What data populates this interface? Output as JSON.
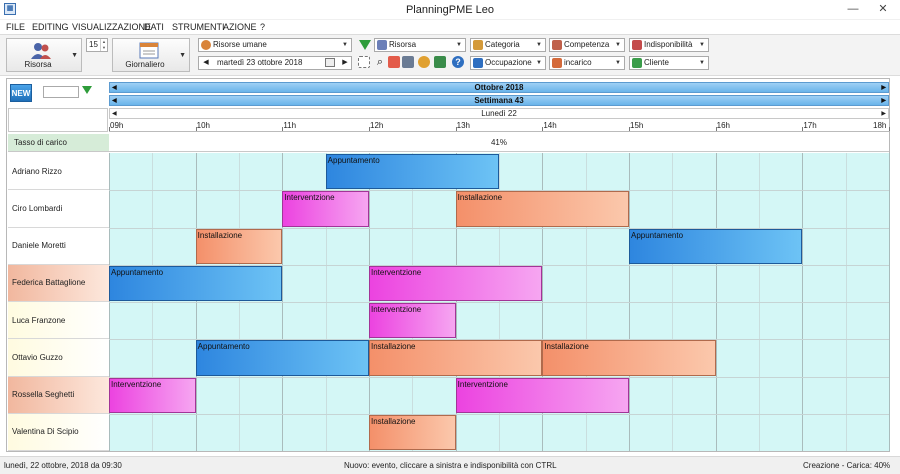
{
  "window": {
    "title": "PlanningPME Leo",
    "app_icon": "calendar-icon",
    "minimize_symbol": "—",
    "close_symbol": "✕"
  },
  "menu": [
    "FILE",
    "EDITING",
    "VISUALIZZAZIONE",
    "DATI",
    "STRUMENTI",
    "AZIONE",
    "?"
  ],
  "toolbar": {
    "resource_button": "Risorsa",
    "interval_value": "15",
    "view_button": "Giornaliero",
    "resource_type": "Risorse umane",
    "date": "martedì  23  ottobre  2018",
    "filters_row1": [
      "Risorsa",
      "Categoria",
      "Competenza",
      "Indisponibilità"
    ],
    "filters_row2": [
      "Occupazione",
      "incarico",
      "Cliente"
    ],
    "icon_colors": {
      "risorsa": "#6b7fb8",
      "categoria": "#d49a3a",
      "competenza": "#c0604a",
      "indisponibilita": "#c44a4a",
      "occupazione": "#2f6fc0",
      "incarico": "#d46a3a",
      "cliente": "#3a9c4a"
    }
  },
  "planning": {
    "new_button": "NEW",
    "month_header": "Ottobre 2018",
    "week_header": "Settimana 43",
    "day_header": "Lunedì 22",
    "hours": [
      "09h",
      "10h",
      "11h",
      "12h",
      "13h",
      "14h",
      "15h",
      "16h",
      "17h",
      "18h"
    ],
    "load_label": "Tasso di carico",
    "load_value": "41%",
    "colors": {
      "header_blue": "#7cc0ee",
      "grid_bg": "#d4f7f6"
    },
    "resources": [
      {
        "name": "Adriano Rizzo",
        "style": "white"
      },
      {
        "name": "Ciro Lombardi",
        "style": "white"
      },
      {
        "name": "Daniele Moretti",
        "style": "white"
      },
      {
        "name": "Federica Battaglione",
        "style": "salmon"
      },
      {
        "name": "Luca Franzone",
        "style": "cream"
      },
      {
        "name": "Ottavio Guzzo",
        "style": "cream"
      },
      {
        "name": "Rossella Seghetti",
        "style": "salmon"
      },
      {
        "name": "Valentina Di Scipio",
        "style": "cream"
      }
    ],
    "events": [
      {
        "resource": 0,
        "start": 11.5,
        "end": 13.5,
        "label": "Appuntamento",
        "type": "appuntamento"
      },
      {
        "resource": 1,
        "start": 11.0,
        "end": 12.0,
        "label": "Interventzione",
        "type": "interventi"
      },
      {
        "resource": 1,
        "start": 13.0,
        "end": 15.0,
        "label": "Installazione",
        "type": "installazione"
      },
      {
        "resource": 2,
        "start": 10.0,
        "end": 11.0,
        "label": "Installazione",
        "type": "installazione"
      },
      {
        "resource": 2,
        "start": 15.0,
        "end": 17.0,
        "label": "Appuntamento",
        "type": "appuntamento"
      },
      {
        "resource": 3,
        "start": 9.0,
        "end": 11.0,
        "label": "Appuntamento",
        "type": "appuntamento"
      },
      {
        "resource": 3,
        "start": 12.0,
        "end": 14.0,
        "label": "Interventzione",
        "type": "interventi"
      },
      {
        "resource": 4,
        "start": 12.0,
        "end": 13.0,
        "label": "Interventzione",
        "type": "interventi"
      },
      {
        "resource": 5,
        "start": 10.0,
        "end": 12.0,
        "label": "Appuntamento",
        "type": "appuntamento"
      },
      {
        "resource": 5,
        "start": 12.0,
        "end": 14.0,
        "label": "Installazione",
        "type": "installazione"
      },
      {
        "resource": 5,
        "start": 14.0,
        "end": 16.0,
        "label": "Installazione",
        "type": "installazione"
      },
      {
        "resource": 6,
        "start": 9.0,
        "end": 10.0,
        "label": "Interventzione",
        "type": "interventi"
      },
      {
        "resource": 6,
        "start": 13.0,
        "end": 15.0,
        "label": "Interventzione",
        "type": "interventi"
      },
      {
        "resource": 7,
        "start": 12.0,
        "end": 13.0,
        "label": "Installazione",
        "type": "installazione"
      }
    ]
  },
  "status": {
    "left": "lunedì, 22 ottobre, 2018 da 09:30",
    "center": "Nuovo: evento, cliccare a sinistra e indisponibilità con CTRL",
    "right": "Creazione - Carica: 40%"
  }
}
